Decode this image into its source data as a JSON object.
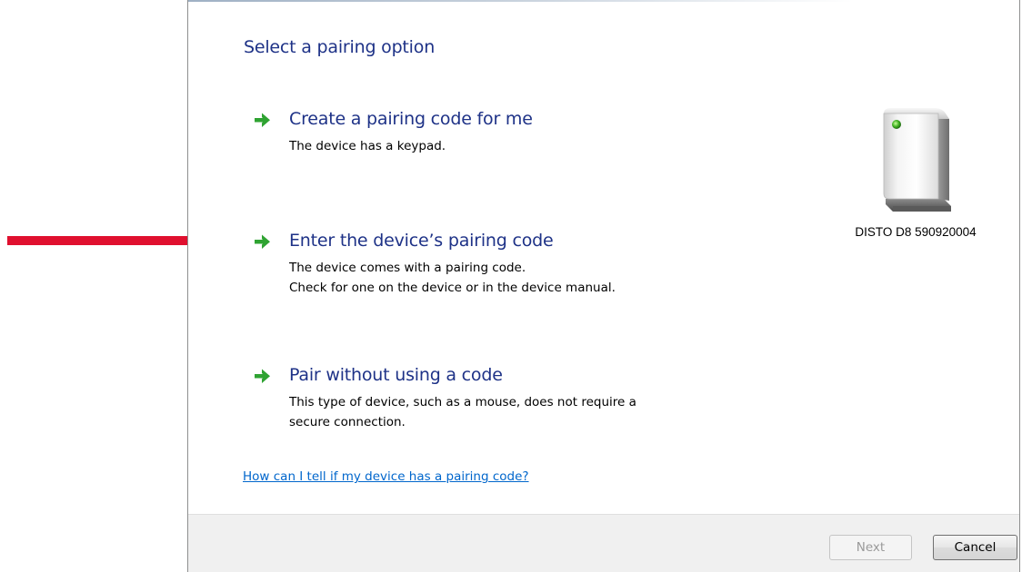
{
  "dialog": {
    "title": "Select a pairing option",
    "options": [
      {
        "title": "Create a pairing code for me",
        "description": [
          "The device has a keypad."
        ]
      },
      {
        "title": "Enter the device’s pairing code",
        "description": [
          "The device comes with a pairing code.",
          "Check for one on the device or in the device manual."
        ]
      },
      {
        "title": "Pair without using a code",
        "description": [
          "This type of device, such as a mouse, does not require a",
          "secure connection."
        ]
      }
    ],
    "device": {
      "name": "DISTO D8 590920004",
      "icon": "generic-device-icon"
    },
    "help_link": "How can I tell if my device has a pairing code?",
    "buttons": {
      "next": "Next",
      "cancel": "Cancel"
    }
  },
  "colors": {
    "heading": "#1e3287",
    "link": "#0066cc",
    "option_arrow": "#2fa332",
    "annotation_arrow": "#e0102f"
  }
}
